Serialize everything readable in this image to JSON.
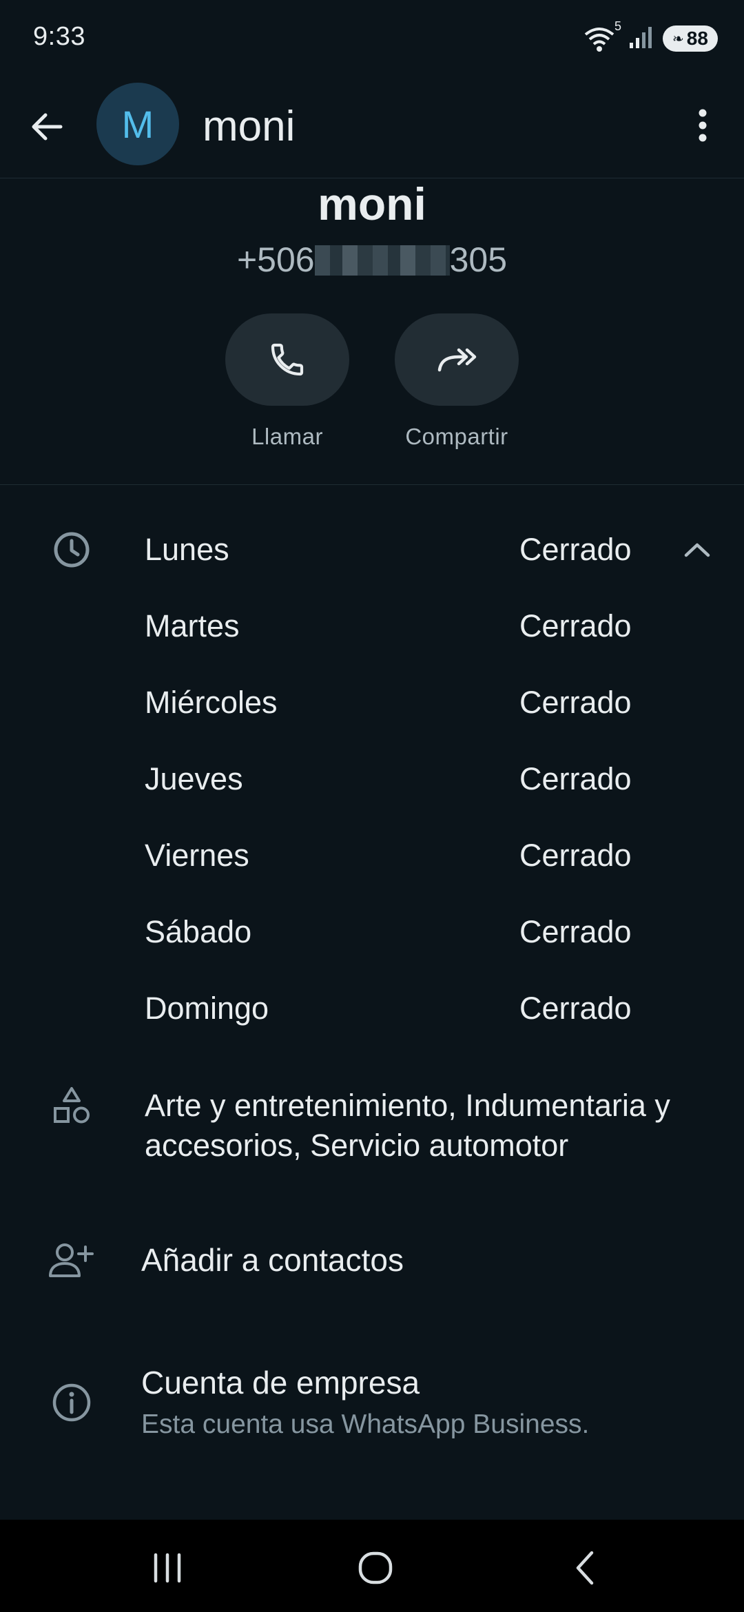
{
  "status_bar": {
    "time": "9:33",
    "wifi_badge": "5",
    "battery": "88",
    "icons": [
      "wifi-icon",
      "signal-icon",
      "battery-icon"
    ]
  },
  "app_bar": {
    "avatar_initial": "M",
    "title": "moni",
    "back_icon": "arrow-left-icon",
    "menu_icon": "more-vert-icon"
  },
  "profile": {
    "name": "moni",
    "phone_prefix": "+506",
    "phone_suffix": "305"
  },
  "actions": [
    {
      "label": "Llamar",
      "icon": "phone-icon"
    },
    {
      "label": "Compartir",
      "icon": "share-forward-icon"
    }
  ],
  "hours": {
    "icon": "clock-icon",
    "collapse_icon": "chevron-up-icon",
    "days": [
      {
        "day": "Lunes",
        "status": "Cerrado"
      },
      {
        "day": "Martes",
        "status": "Cerrado"
      },
      {
        "day": "Miércoles",
        "status": "Cerrado"
      },
      {
        "day": "Jueves",
        "status": "Cerrado"
      },
      {
        "day": "Viernes",
        "status": "Cerrado"
      },
      {
        "day": "Sábado",
        "status": "Cerrado"
      },
      {
        "day": "Domingo",
        "status": "Cerrado"
      }
    ]
  },
  "category": {
    "icon": "shapes-icon",
    "line1": "Arte y entretenimiento, Indumentaria y",
    "line2": "accesorios, Servicio automotor"
  },
  "add_contact": {
    "icon": "person-add-icon",
    "label": "Añadir a contactos"
  },
  "business": {
    "icon": "info-icon",
    "title": "Cuenta de empresa",
    "subtitle": "Esta cuenta usa WhatsApp Business."
  },
  "nav_bar": {
    "icons": [
      "recents-icon",
      "home-icon",
      "back-nav-icon"
    ]
  },
  "colors": {
    "background": "#0b141a",
    "text_primary": "#e9edef",
    "text_secondary": "#8696a0",
    "avatar_bg": "#1b3a4f",
    "avatar_text": "#53bdeb",
    "button_bg": "#222d34"
  }
}
